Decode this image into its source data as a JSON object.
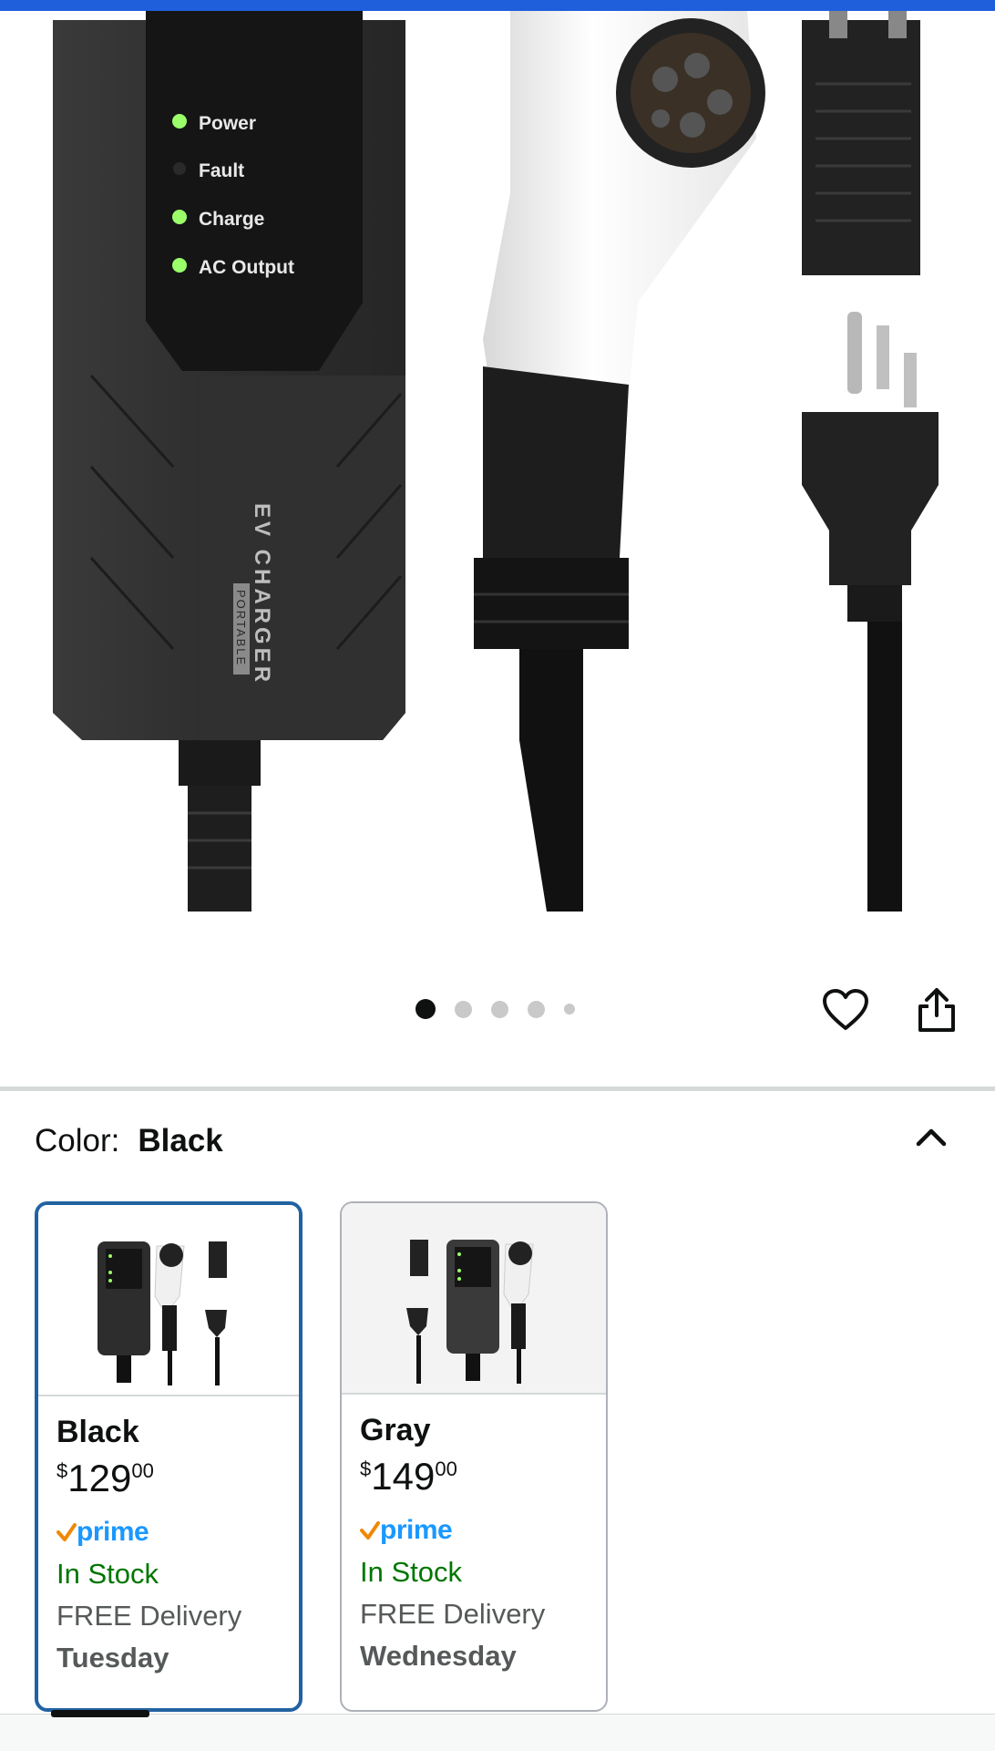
{
  "product_image": {
    "alt": "EV charger product photo",
    "panel_labels": [
      "Power",
      "Fault",
      "Charge",
      "AC Output"
    ],
    "brand_text": "EV CHARGER",
    "sub_text": "PORTABLE"
  },
  "carousel": {
    "total": 5,
    "active_index": 1
  },
  "color": {
    "label": "Color:",
    "selected": "Black"
  },
  "swatches": [
    {
      "name": "Black",
      "price_symbol": "$",
      "price_whole": "129",
      "price_fraction": "00",
      "prime": "prime",
      "stock": "In Stock",
      "delivery": "FREE Delivery",
      "day": "Tuesday",
      "selected": true
    },
    {
      "name": "Gray",
      "price_symbol": "$",
      "price_whole": "149",
      "price_fraction": "00",
      "prime": "prime",
      "stock": "In Stock",
      "delivery": "FREE Delivery",
      "day": "Wednesday",
      "selected": false
    }
  ],
  "colors": {
    "accent_blue": "#2162a1",
    "in_stock_green": "#007600",
    "prime_blue": "#1a98ff",
    "prime_check": "#f08804",
    "top_bar": "#1f5fdc"
  }
}
